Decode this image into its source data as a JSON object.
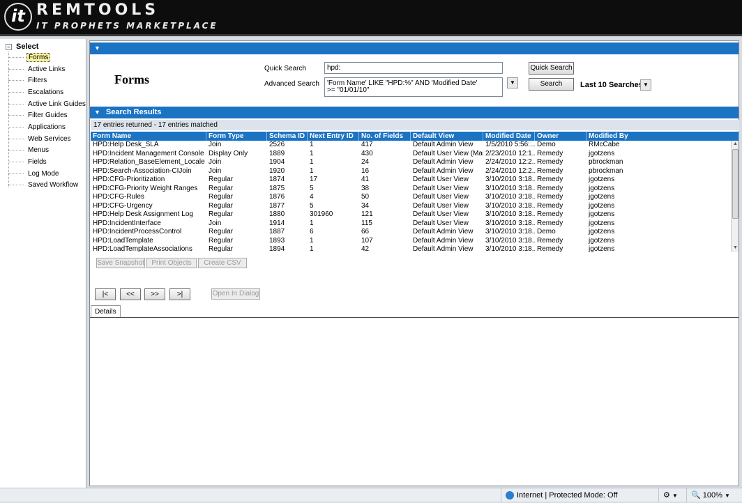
{
  "header": {
    "logo_mark": "it",
    "logo_title": "REMTOOLS",
    "logo_subtitle": "IT PROPHETS MARKETPLACE"
  },
  "tree": {
    "root_label": "Select",
    "expander": "−",
    "items": [
      {
        "label": "Forms",
        "selected": true
      },
      {
        "label": "Active Links"
      },
      {
        "label": "Filters"
      },
      {
        "label": "Escalations"
      },
      {
        "label": "Active Link Guides"
      },
      {
        "label": "Filter Guides"
      },
      {
        "label": "Applications"
      },
      {
        "label": "Web Services"
      },
      {
        "label": "Menus"
      },
      {
        "label": "Fields"
      },
      {
        "label": "Log Mode"
      },
      {
        "label": "Saved Workflow"
      }
    ]
  },
  "top_bar": {
    "arrow": "▼"
  },
  "search": {
    "page_title": "Forms",
    "quick_search_label": "Quick Search",
    "quick_search_value": "hpd:",
    "advanced_search_label": "Advanced Search",
    "advanced_search_line1": "'Form Name'  LIKE \"HPD:%\"   AND  'Modified Date'",
    "advanced_search_line2": ">= \"01/01/10\"",
    "quick_search_button": "Quick Search",
    "search_button": "Search",
    "last_searches_label": "Last 10 Searches",
    "dropdown_arrow": "▼"
  },
  "results": {
    "bar_label": "Search Results",
    "arrow": "▼",
    "summary": "17 entries returned - 17 entries matched",
    "columns": [
      "Form Name",
      "Form Type",
      "Schema ID",
      "Next Entry ID",
      "No. of Fields",
      "Default View",
      "Modified Date",
      "Owner",
      "Modified By"
    ],
    "rows": [
      [
        "HPD:Help Desk_SLA",
        "Join",
        "2526",
        "1",
        "417",
        "Default Admin View",
        "1/5/2010 5:56:...",
        "Demo",
        "RMcCabe"
      ],
      [
        "HPD:Incident Management Console",
        "Display Only",
        "1889",
        "1",
        "430",
        "Default User View (Man...",
        "2/23/2010 12:1...",
        "Remedy",
        "jgotzens"
      ],
      [
        "HPD:Relation_BaseElement_Locale",
        "Join",
        "1904",
        "1",
        "24",
        "Default Admin View",
        "2/24/2010 12:2...",
        "Remedy",
        "pbrockman"
      ],
      [
        "HPD:Search-Association-CIJoin",
        "Join",
        "1920",
        "1",
        "16",
        "Default Admin View",
        "2/24/2010 12:2...",
        "Remedy",
        "pbrockman"
      ],
      [
        "HPD:CFG-Prioritization",
        "Regular",
        "1874",
        "17",
        "41",
        "Default User View",
        "3/10/2010 3:18...",
        "Remedy",
        "jgotzens"
      ],
      [
        "HPD:CFG-Priority Weight Ranges",
        "Regular",
        "1875",
        "5",
        "38",
        "Default User View",
        "3/10/2010 3:18...",
        "Remedy",
        "jgotzens"
      ],
      [
        "HPD:CFG-Rules",
        "Regular",
        "1876",
        "4",
        "50",
        "Default User View",
        "3/10/2010 3:18...",
        "Remedy",
        "jgotzens"
      ],
      [
        "HPD:CFG-Urgency",
        "Regular",
        "1877",
        "5",
        "34",
        "Default User View",
        "3/10/2010 3:18...",
        "Remedy",
        "jgotzens"
      ],
      [
        "HPD:Help Desk Assignment Log",
        "Regular",
        "1880",
        "301960",
        "121",
        "Default User View",
        "3/10/2010 3:18...",
        "Remedy",
        "jgotzens"
      ],
      [
        "HPD:IncidentInterface",
        "Join",
        "1914",
        "1",
        "115",
        "Default User View",
        "3/10/2010 3:18...",
        "Remedy",
        "jgotzens"
      ],
      [
        "HPD:IncidentProcessControl",
        "Regular",
        "1887",
        "6",
        "66",
        "Default Admin View",
        "3/10/2010 3:18...",
        "Demo",
        "jgotzens"
      ],
      [
        "HPD:LoadTemplate",
        "Regular",
        "1893",
        "1",
        "107",
        "Default Admin View",
        "3/10/2010 3:18...",
        "Remedy",
        "jgotzens"
      ],
      [
        "HPD:LoadTemplateAssociations",
        "Regular",
        "1894",
        "1",
        "42",
        "Default Admin View",
        "3/10/2010 3:18...",
        "Remedy",
        "jgotzens"
      ]
    ],
    "scroll_up": "▲",
    "scroll_down": "▼"
  },
  "actions": {
    "save_snapshot": "Save Snapshot",
    "print_objects": "Print Objects",
    "create_csv": "Create CSV",
    "first": "|<",
    "prev": "<<",
    "next": ">>",
    "last": ">|",
    "open_in_dialog": "Open In Dialog"
  },
  "details_tab": "Details",
  "status_bar": {
    "zone": "Internet | Protected Mode: Off",
    "zoom": "100%",
    "dropdown": "▼"
  }
}
